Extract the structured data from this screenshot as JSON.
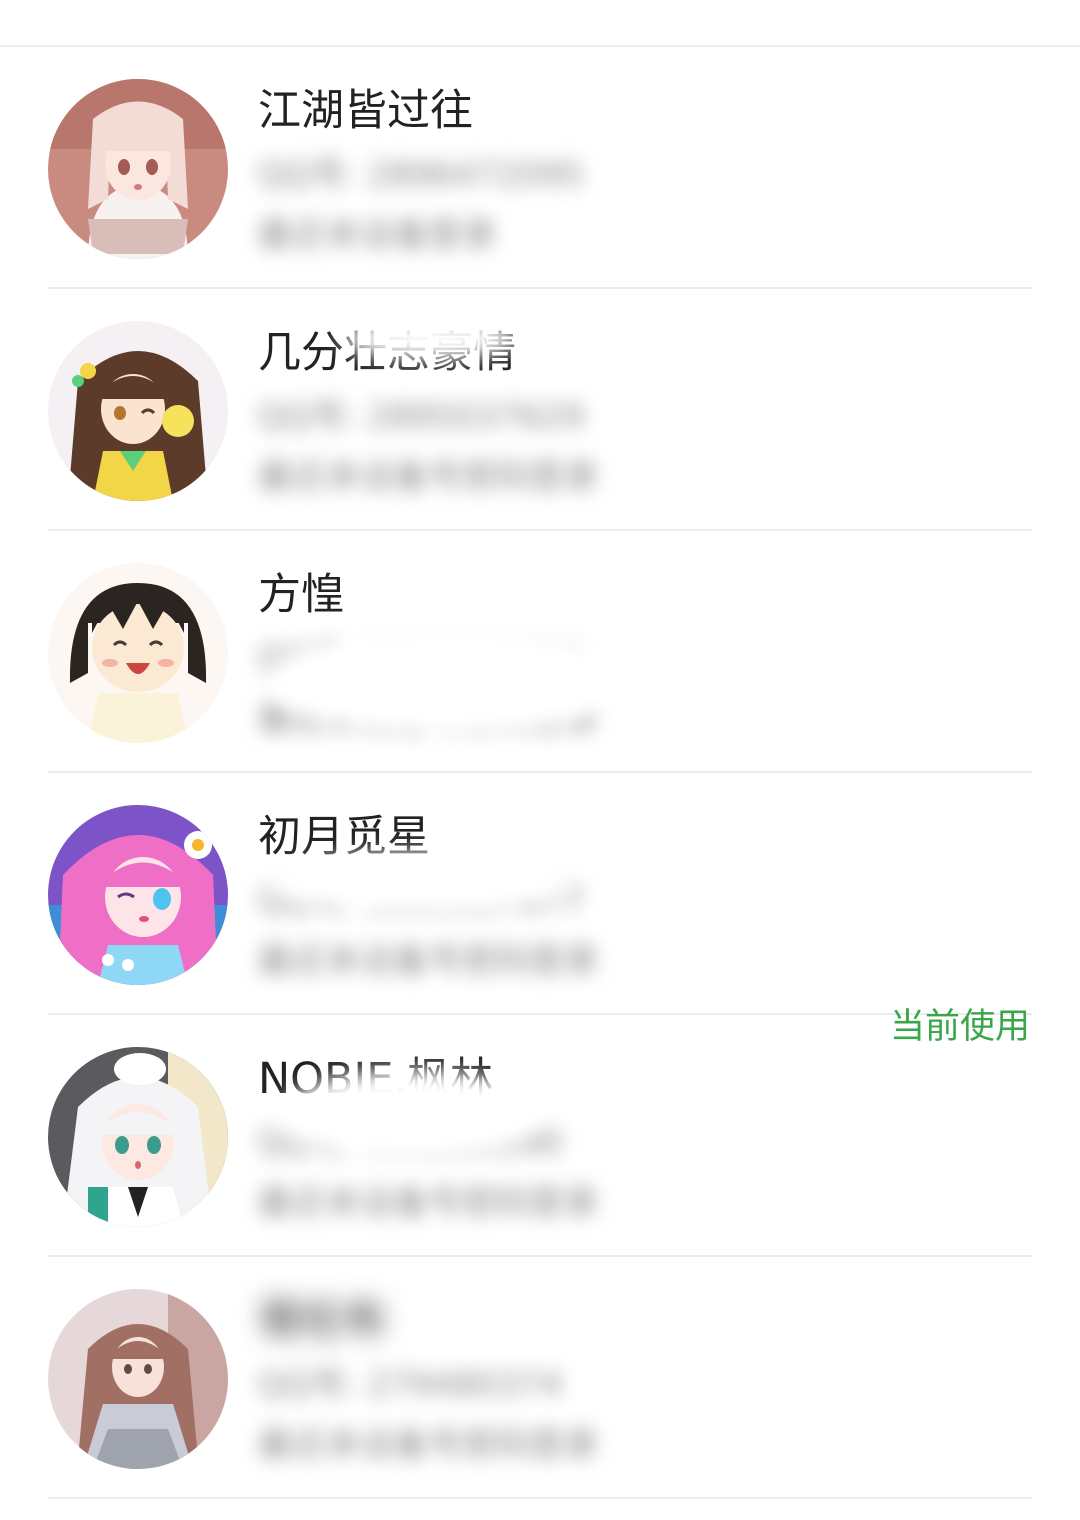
{
  "accounts": [
    {
      "name": "江湖皆过往",
      "id_line": "QQ号: 2896472095",
      "login_line": "最近本设备登录",
      "current": false,
      "avatar_colors": {
        "bg": "#c98a7f",
        "hair": "#f3dcd6",
        "skin": "#fbe7df",
        "accent": "#a45b55"
      }
    },
    {
      "name": "几分壮志豪情",
      "id_line": "QQ号: 2895037629",
      "login_line": "最近本设备号密码登录",
      "current": false,
      "avatar_colors": {
        "bg": "#f4f0f4",
        "hair": "#5d3b2a",
        "skin": "#fbe3d2",
        "accent": "#f3d548"
      }
    },
    {
      "name": "方惶",
      "id_line": "QQ号: 2895631751",
      "login_line": "最近本设备号密码登录",
      "current": false,
      "avatar_colors": {
        "bg": "#fdf7f4",
        "hair": "#2b2522",
        "skin": "#fce9d4",
        "accent": "#f5b3a3"
      }
    },
    {
      "name": "初月觅星",
      "id_line": "QQ号: 2895227677",
      "login_line": "最近本设备号密码登录",
      "current": false,
      "avatar_colors": {
        "bg": "#7c54c8",
        "hair": "#f06fc6",
        "skin": "#fde4e8",
        "accent": "#4fc3f0"
      }
    },
    {
      "name": "NOBIE.枫林",
      "id_line": "QQ号: 953205590",
      "login_line": "最近本设备号密码登录",
      "current": true,
      "current_label": "当前使用",
      "avatar_colors": {
        "bg": "#5b5a5e",
        "hair": "#f4f4f6",
        "skin": "#fde8e2",
        "accent": "#3a9c8e"
      }
    },
    {
      "name": "哥伦布",
      "id_line": "QQ号: 279480374",
      "login_line": "最近本设备号密码登录",
      "current": false,
      "avatar_colors": {
        "bg": "#e6d8d8",
        "hair": "#a26f64",
        "skin": "#f7e1d8",
        "accent": "#9fa3ae"
      }
    }
  ],
  "colors": {
    "accent_green": "#3aa64a",
    "name_text": "#222222",
    "secondary_text": "#8a8a8a",
    "divider": "#ececec"
  }
}
